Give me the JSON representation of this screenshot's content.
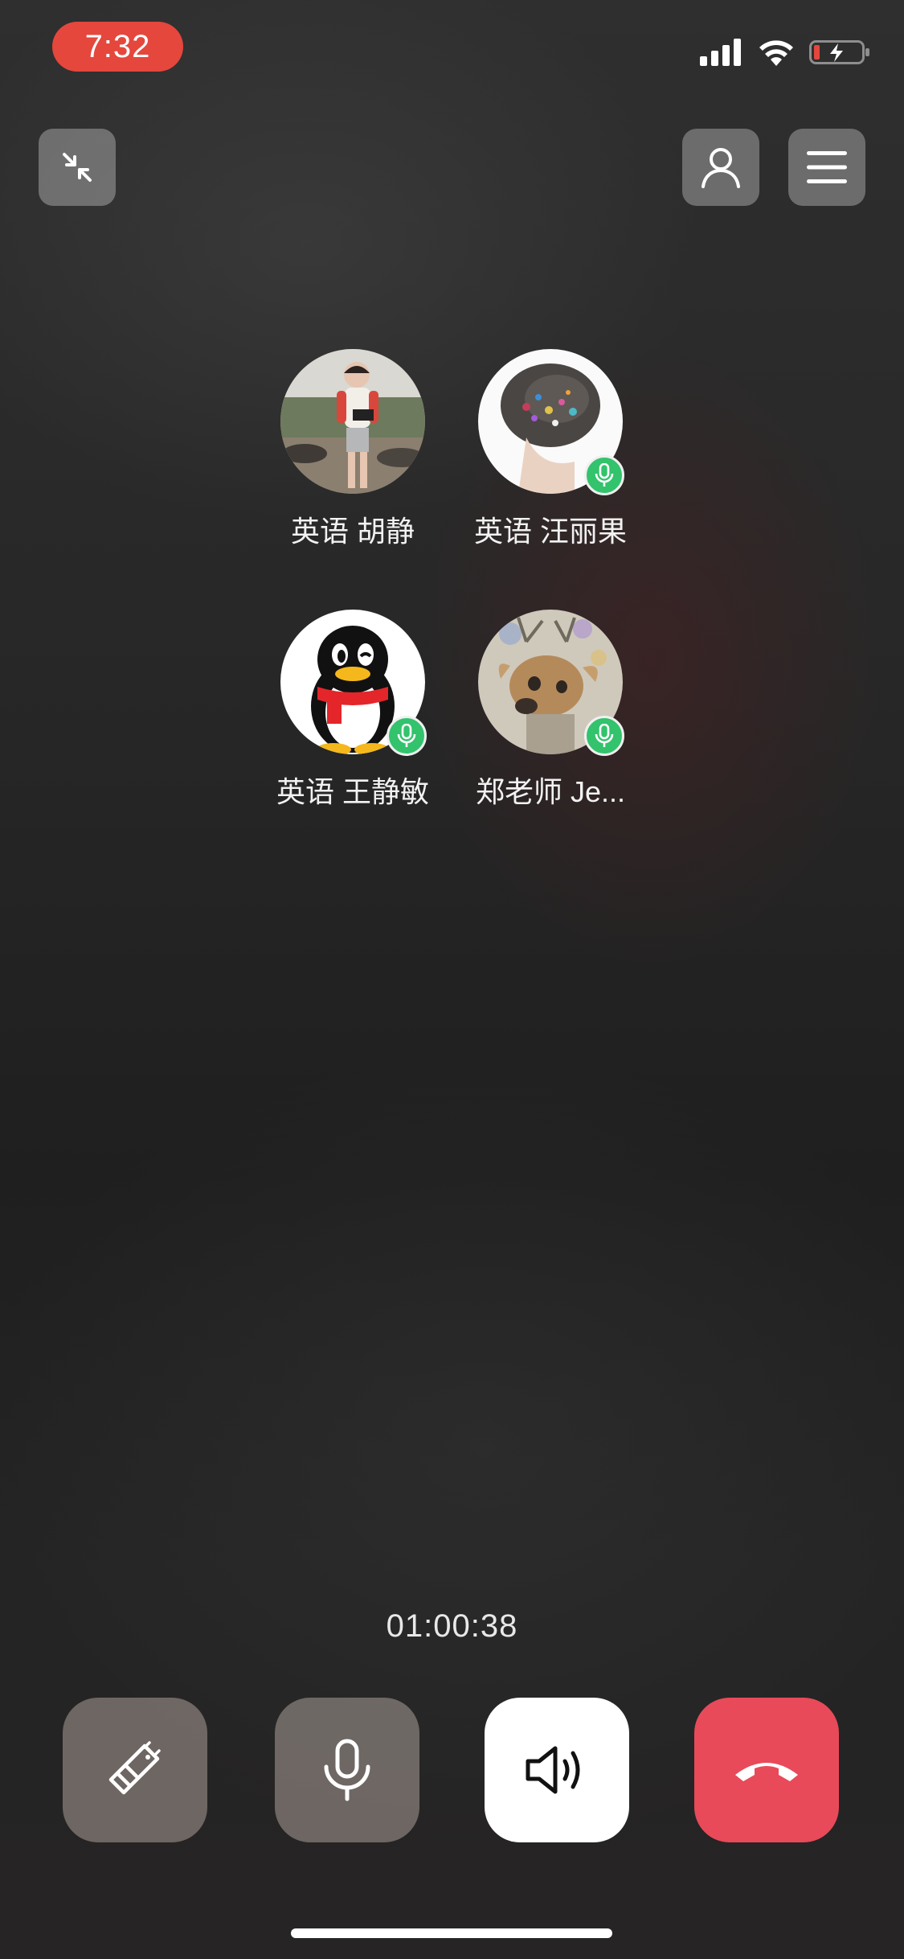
{
  "status_bar": {
    "time": "7:32",
    "icons": [
      "cellular-signal-icon",
      "wifi-icon",
      "battery-low-charging-icon"
    ]
  },
  "top_bar": {
    "left_icon": "minimize-icon",
    "right_icons": [
      "add-member-icon",
      "menu-icon"
    ]
  },
  "participants": [
    {
      "name": "英语 胡静",
      "avatar": "photo-girl",
      "mic_active": false
    },
    {
      "name": "英语 汪丽果",
      "avatar": "photo-hair",
      "mic_active": true
    },
    {
      "name": "英语 王静敏",
      "avatar": "qq-penguin",
      "mic_active": true
    },
    {
      "name": "郑老师 Je...",
      "avatar": "photo-deer",
      "mic_active": true
    }
  ],
  "call": {
    "duration": "01:00:38"
  },
  "controls": [
    {
      "name": "effects",
      "icon": "magic-wand-icon"
    },
    {
      "name": "microphone",
      "icon": "microphone-icon"
    },
    {
      "name": "speaker",
      "icon": "speaker-icon"
    },
    {
      "name": "hang-up",
      "icon": "hang-up-icon"
    }
  ],
  "colors": {
    "status_time_bg": "#e5473d",
    "mic_badge": "#32c36c",
    "hang_up": "#e84a5a",
    "control_bg": "#b9aca4"
  }
}
